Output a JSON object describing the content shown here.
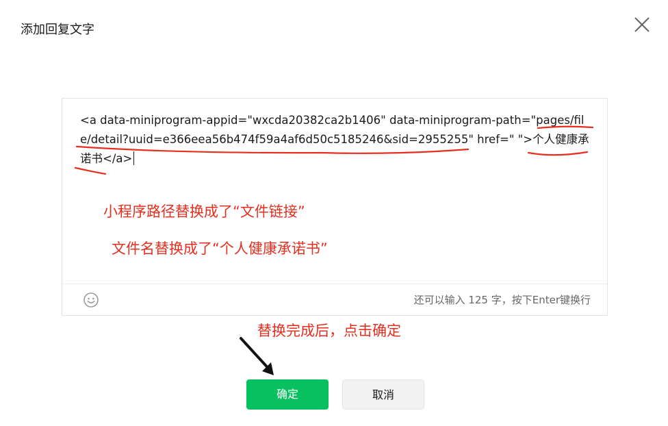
{
  "dialog": {
    "title": "添加回复文字"
  },
  "editor": {
    "lines": [
      "<a data-miniprogram-appid=\"wxcda20382ca2b1406\" data-miniprogram-path=\"pages/fil",
      "e/detail?uuid=e366eea56b474f59a4af6d50c5185246&sid=2955255\" href=\" \">个人健康承",
      "诺书</a>"
    ],
    "char_count_hint": "还可以输入 125 字，按下Enter键换行"
  },
  "annotations": {
    "path_note": "小程序路径替换成了“文件链接”",
    "name_note": "文件名替换成了“个人健康承诺书”",
    "action_note": "替换完成后，点击确定"
  },
  "buttons": {
    "confirm": "确定",
    "cancel": "取消"
  },
  "colors": {
    "accent_green": "#07c160",
    "annotation_red": "#e62e1e"
  },
  "icons": {
    "close": "close-icon",
    "emoji": "emoji-icon",
    "arrow": "arrow-icon"
  }
}
